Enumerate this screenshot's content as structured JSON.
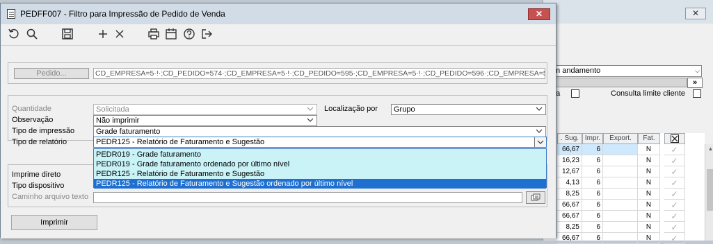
{
  "dialog": {
    "title": "PEDFF007 - Filtro para Impressão de Pedido de Venda",
    "close_glyph": "✕"
  },
  "toolbar": {
    "icons": [
      "refresh-icon",
      "search-icon",
      "save-icon",
      "add-icon",
      "delete-icon",
      "print-icon",
      "calendar-icon",
      "help-icon",
      "exit-icon"
    ]
  },
  "pedido": {
    "button_label": "Pedido...",
    "value": "CD_EMPRESA=5·!·;CD_PEDIDO=574·;CD_EMPRESA=5·!·;CD_PEDIDO=595·;CD_EMPRESA=5·!·;CD_PEDIDO=596·;CD_EMPRESA=5·!·;CD"
  },
  "form": {
    "quantidade_label": "Quantidade",
    "quantidade_value": "Solicitada",
    "localizacao_label": "Localização por",
    "localizacao_value": "Grupo",
    "observacao_label": "Observação",
    "observacao_value": "Não imprimir",
    "tipo_impressao_label": "Tipo de impressão",
    "tipo_impressao_value": "Grade faturamento",
    "tipo_relatorio_label": "Tipo de relatório",
    "tipo_relatorio_value": "PEDR125 - Relatório de Faturamento e Sugestão"
  },
  "dropdown": {
    "options": [
      "PEDR019 - Grade faturamento",
      "PEDR019 - Grade faturamento ordenado por último nível",
      "PEDR125 - Relatório de Faturamento e Sugestão",
      "PEDR125 - Relatório de Faturamento e Sugestão ordenado por último nível"
    ],
    "selected_index": 3
  },
  "lower": {
    "imprime_direto_label": "Imprime direto",
    "tipo_dispositivo_label": "Tipo dispositivo",
    "caminho_label": "Caminho arquivo texto"
  },
  "imprimir_label": "Imprimir",
  "background": {
    "close_glyph": "✕",
    "select_value": "m andamento",
    "arrow_label": "»",
    "check1_label": "da",
    "check2_label": "Consulta limite cliente",
    "grid_headers": [
      ". Sug.",
      "Impr.",
      "Export.",
      "Fat."
    ],
    "rows": [
      {
        "sug": "66,67",
        "impr": "6",
        "fat": "N"
      },
      {
        "sug": "16,23",
        "impr": "6",
        "fat": "N"
      },
      {
        "sug": "12,67",
        "impr": "6",
        "fat": "N"
      },
      {
        "sug": "4,13",
        "impr": "6",
        "fat": "N"
      },
      {
        "sug": "8,25",
        "impr": "6",
        "fat": "N"
      },
      {
        "sug": "66,67",
        "impr": "6",
        "fat": "N"
      },
      {
        "sug": "66,67",
        "impr": "6",
        "fat": "N"
      },
      {
        "sug": "8,25",
        "impr": "6",
        "fat": "N"
      },
      {
        "sug": "66,67",
        "impr": "6",
        "fat": "N"
      }
    ]
  }
}
